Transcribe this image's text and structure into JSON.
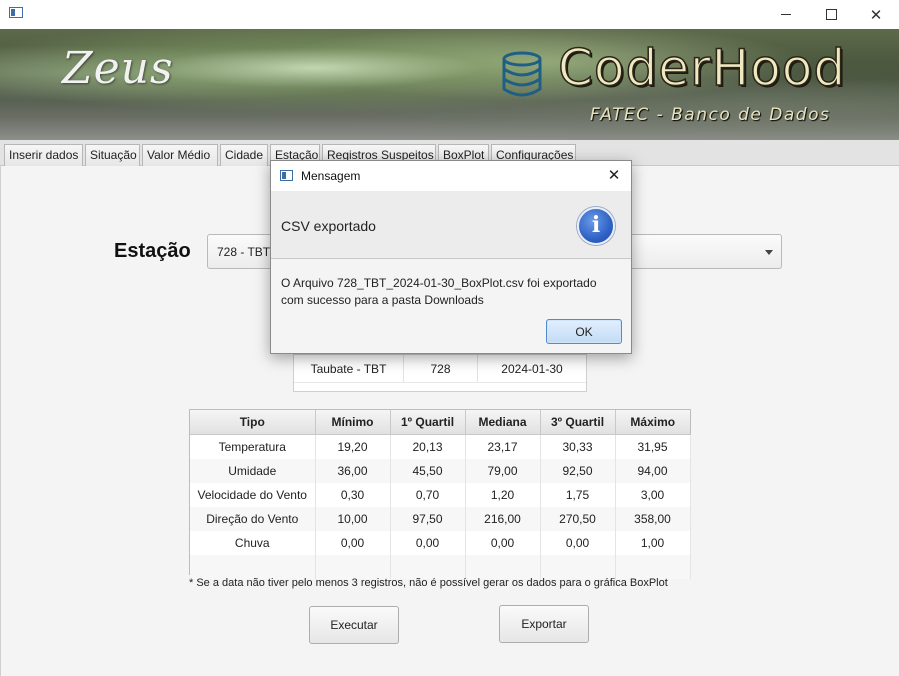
{
  "banner": {
    "left_title": "Zeus",
    "brand": "CoderHood",
    "subtitle": "FATEC - Banco de Dados"
  },
  "tabs": [
    {
      "label": "Inserir dados"
    },
    {
      "label": "Situação"
    },
    {
      "label": "Valor Médio"
    },
    {
      "label": "Cidade"
    },
    {
      "label": "Estação",
      "selected": true
    },
    {
      "label": "Registros Suspeitos"
    },
    {
      "label": "BoxPlot"
    },
    {
      "label": "Configurações"
    }
  ],
  "form": {
    "estacao_label": "Estação",
    "estacao_value": "728 - TBT"
  },
  "info_table": {
    "cells": [
      "Taubate - TBT",
      "728",
      "2024-01-30"
    ]
  },
  "stats_table": {
    "headers": [
      "Tipo",
      "Mínimo",
      "1º Quartil",
      "Mediana",
      "3º Quartil",
      "Máximo"
    ],
    "rows": [
      [
        "Temperatura",
        "19,20",
        "20,13",
        "23,17",
        "30,33",
        "31,95"
      ],
      [
        "Umidade",
        "36,00",
        "45,50",
        "79,00",
        "92,50",
        "94,00"
      ],
      [
        "Velocidade do Vento",
        "0,30",
        "0,70",
        "1,20",
        "1,75",
        "3,00"
      ],
      [
        "Direção do Vento",
        "10,00",
        "97,50",
        "216,00",
        "270,50",
        "358,00"
      ],
      [
        "Chuva",
        "0,00",
        "0,00",
        "0,00",
        "0,00",
        "1,00"
      ]
    ]
  },
  "note": "* Se a data não tiver pelo menos 3 registros, não é possível gerar os dados para o gráfica BoxPlot",
  "buttons": {
    "executar": "Executar",
    "exportar": "Exportar"
  },
  "dialog": {
    "title": "Mensagem",
    "header": "CSV exportado",
    "message": "O Arquivo 728_TBT_2024-01-30_BoxPlot.csv foi exportado com sucesso para a pasta Downloads",
    "ok": "OK",
    "icon": "info-icon"
  },
  "colors": {
    "ok_border": "#4f8ccd",
    "info_icon": "#2f62c6"
  }
}
